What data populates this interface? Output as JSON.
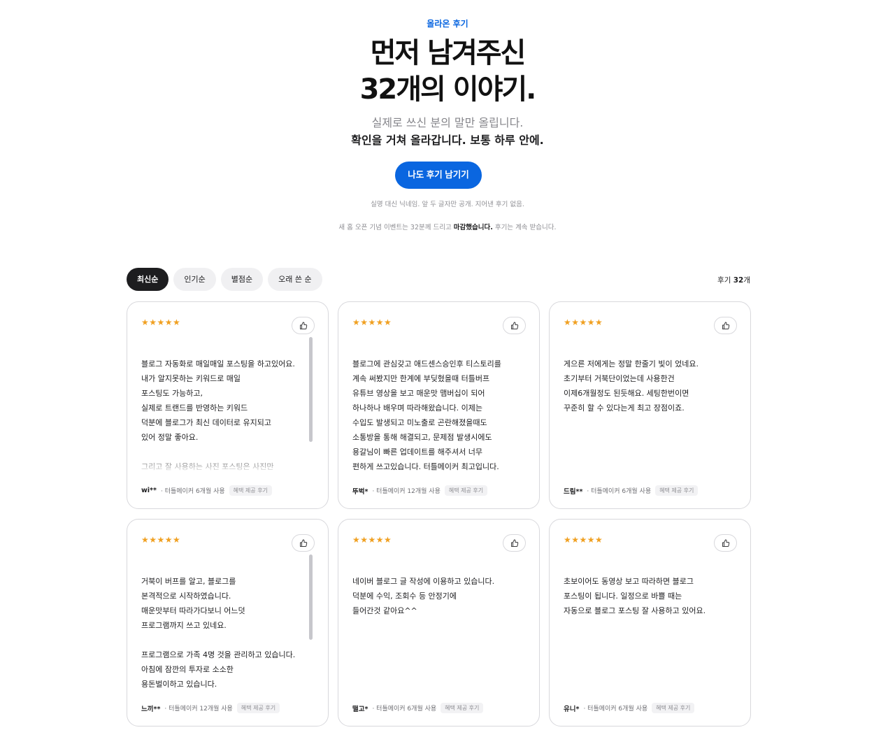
{
  "hero": {
    "eyebrow": "올라온 후기",
    "headline_line1": "먼저 남겨주신",
    "headline_line2": "32개의 이야기.",
    "sub_line1": "실제로 쓰신 분의 말만 올립니다.",
    "sub_line2": "확인을 거쳐 올라갑니다. 보통 하루 안에.",
    "cta_label": "나도 후기 남기기",
    "note1": "실명 대신 닉네임. 앞 두 글자만 공개. 지어낸 후기 없음.",
    "note2_pre": "새 홈 오픈 기념 이벤트는 32분께 드리고 ",
    "note2_bold": "마감했습니다.",
    "note2_post": " 후기는 계속 받습니다."
  },
  "filters": {
    "tabs": [
      "최신순",
      "인기순",
      "별점순",
      "오래 쓴 순"
    ],
    "active": "최신순",
    "count_label": "후기",
    "count_value": "32",
    "count_unit": "개"
  },
  "colors": {
    "accent": "#0a66e0",
    "star": "#f0a021",
    "active_chip": "#1d1d1f"
  },
  "icons": {
    "like": "thumbs-up-icon",
    "rating": "star-icon"
  },
  "reviews": [
    {
      "stars": "★★★★★",
      "rating": 5,
      "text": "블로그 자동화로 매일매일 포스팅을 하고있어요.\n내가 알지못하는 키워드로 매일\n포스팅도 가능하고,\n실제로 트랜드를 반영하는 키워드\n덕분에 블로그가 최신 데이터로 유지되고\n있어 정말 좋아요.\n\n그리고 잘 사용하는 사진 포스팅은 사진만\n몇장 올리면 자동으로 포스팅이되니깐",
      "author": "wi**",
      "usage": "· 터틀메이커 6개월 사용",
      "badge": "혜택 제공 후기"
    },
    {
      "stars": "★★★★★",
      "rating": 5,
      "text": "블로그에 관심갖고 애드센스승인후 티스토리를\n계속 써봤지만 한계에 부딪혔을때 터틀버프\n유튜브 영상을 보고 매운맛 맴버십이 되어\n하나하나 배우며 따라해왔습니다. 이제는\n수입도 발생되고 미노출로 곤란해졌을때도\n소통방을 통해 해결되고, 문제점 발생시에도\n용갈님이 빠른 업데이트를 해주셔서 너무\n편하게 쓰고있습니다. 터틀메이커 최고입니다.",
      "author": "뚜벅*",
      "usage": "· 터틀메이커 12개월 사용",
      "badge": "혜택 제공 후기"
    },
    {
      "stars": "★★★★★",
      "rating": 5,
      "text": "게으른 저에게는 정말 한줄기 빛이 었네요.\n초기부터 거북단이었는데 사용한건\n이제6개월정도 된듯해요. 세팅한번이면\n꾸준히 할 수 있다는게 최고 장점이죠.",
      "author": "드림**",
      "usage": "· 터틀메이커 6개월 사용",
      "badge": "혜택 제공 후기"
    },
    {
      "stars": "★★★★★",
      "rating": 5,
      "text": "거북이 버프를 알고, 블로그를\n본격적으로 시작하였습니다.\n매운맛부터 따라가다보니 어느덧\n프로그램까지 쓰고 있네요.\n\n프로그램으로 가족 4명 것을 관리하고 있습니다.\n아침에 잠깐의 투자로 소소한\n용돈벌이하고 있습니다.",
      "author": "느끼**",
      "usage": "· 터틀메이커 12개월 사용",
      "badge": "혜택 제공 후기"
    },
    {
      "stars": "★★★★★",
      "rating": 5,
      "text": "네이버 블로그 글 작성에 이용하고 있습니다.\n덕분에 수익, 조회수 등 안정기에\n들어간것 같아요^^",
      "author": "떨고*",
      "usage": "· 터틀메이커 6개월 사용",
      "badge": "혜택 제공 후기"
    },
    {
      "stars": "★★★★★",
      "rating": 5,
      "text": "초보이어도 동영상 보고 따라하면 블로그\n포스팅이 됩니다. 일정으로 바쁠 때는\n자동으로 블로그 포스팅 잘 사용하고 있어요.",
      "author": "유니*",
      "usage": "· 터틀메이커 6개월 사용",
      "badge": "혜택 제공 후기"
    }
  ]
}
